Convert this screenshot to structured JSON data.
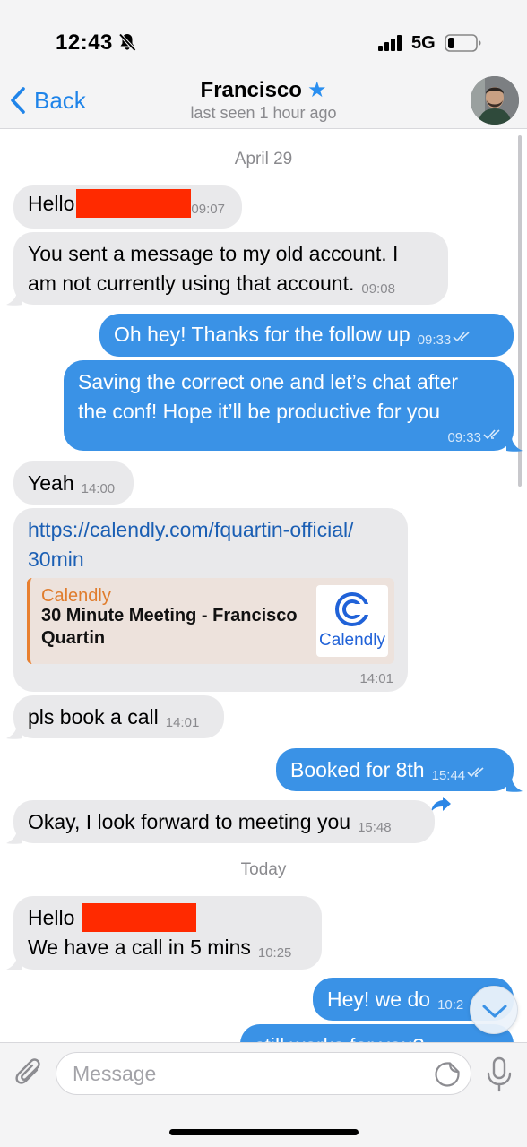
{
  "status_bar": {
    "time": "12:43",
    "network": "5G",
    "icons": [
      "bell-slash-icon",
      "signal-bars-icon",
      "battery-icon"
    ],
    "battery_level": 0.2
  },
  "nav": {
    "back_label": "Back",
    "contact_name": "Francisco",
    "contact_star": "★",
    "last_seen": "last seen 1 hour ago"
  },
  "chat": {
    "date_1": "April 29",
    "date_2": "Today",
    "messages": [
      {
        "dir": "in",
        "text": "Hello",
        "redacted": true,
        "time": "09:07"
      },
      {
        "dir": "in",
        "text_1": "You sent a message to my old account. I",
        "text_2": "am not currently using that account.",
        "time": "09:08"
      },
      {
        "dir": "out",
        "text": "Oh hey! Thanks for the follow up",
        "time": "09:33",
        "read": true
      },
      {
        "dir": "out",
        "text_1": "Saving the correct one and let’s chat after",
        "text_2": "the conf! Hope it’ll be productive for you",
        "time": "09:33",
        "read": true
      },
      {
        "dir": "in",
        "text": "Yeah",
        "time": "14:00"
      },
      {
        "dir": "in",
        "link_1": "https://calendly.com/fquartin-official/",
        "link_2": "30min",
        "preview_site": "Calendly",
        "preview_title": "30 Minute Meeting - Francisco Quartin",
        "preview_logo_text": "Calendly",
        "time": "14:01"
      },
      {
        "dir": "in",
        "text": "pls book a call",
        "time": "14:01"
      },
      {
        "dir": "out",
        "text": "Booked for 8th",
        "time": "15:44",
        "read": true
      },
      {
        "dir": "in",
        "text": "Okay, I look forward to meeting you",
        "time": "15:48"
      },
      {
        "dir": "in",
        "text_1": "Hello",
        "text_2": "We have a call in 5 mins",
        "redacted": true,
        "time": "10:25"
      },
      {
        "dir": "out",
        "text": "Hey! we do",
        "time": "10:2",
        "read": true
      },
      {
        "dir": "out",
        "text": "still works for you?",
        "partial": true
      }
    ]
  },
  "input": {
    "placeholder": "Message"
  },
  "colors": {
    "accent": "#1f84e9",
    "outgoing_bubble": "#3a92e6",
    "incoming_bubble": "#e9e9eb",
    "redaction": "#ff2a00",
    "preview_accent": "#e87f2f"
  }
}
